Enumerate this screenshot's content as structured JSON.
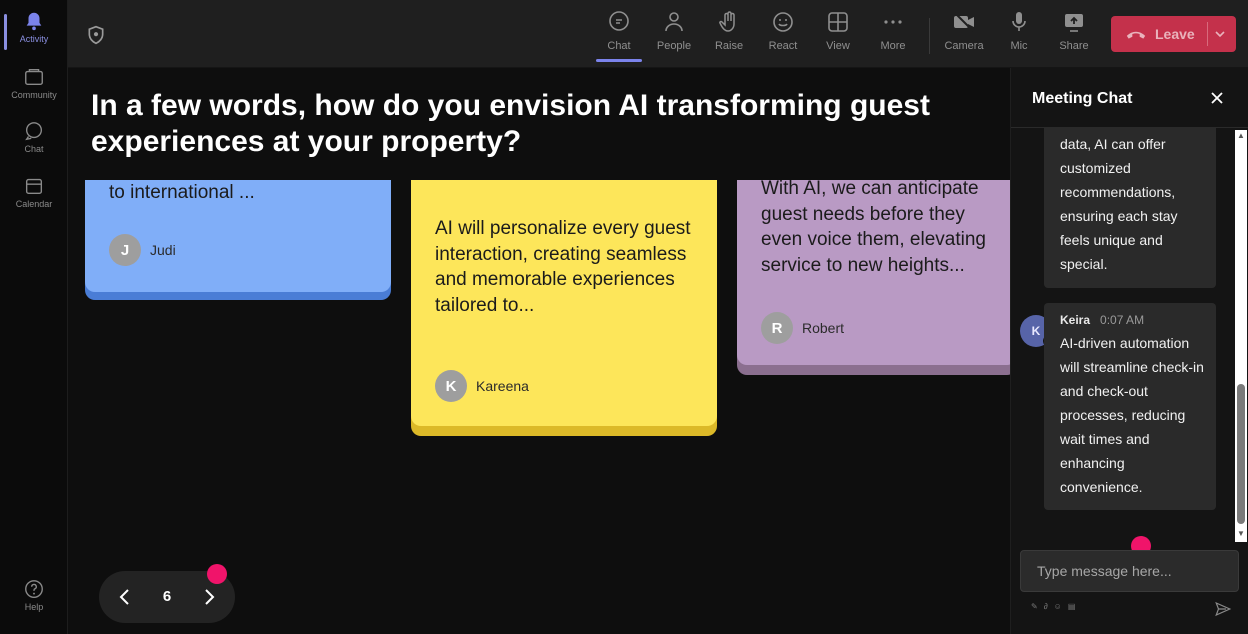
{
  "rail": {
    "items": [
      {
        "label": "Activity",
        "icon": "bell-icon",
        "active": true
      },
      {
        "label": "Community",
        "icon": "community-icon"
      },
      {
        "label": "Chat",
        "icon": "chat-icon"
      },
      {
        "label": "Calendar",
        "icon": "calendar-icon"
      },
      {
        "label": "Help",
        "icon": "help-icon"
      }
    ]
  },
  "toolbar": {
    "chat": "Chat",
    "people": "People",
    "raise": "Raise",
    "react": "React",
    "view": "View",
    "more": "More",
    "camera": "Camera",
    "mic": "Mic",
    "share": "Share",
    "leave": "Leave"
  },
  "stage": {
    "question": "In a few words, how do you envision AI transforming guest experiences at your property?",
    "notes": [
      {
        "text": "to international ...",
        "author": "Judi",
        "initial": "J",
        "color": "#80aef8"
      },
      {
        "text": "AI will personalize every guest interaction, creating seamless and memorable experiences tailored to...",
        "author": "Kareena",
        "initial": "K",
        "color": "#fde65a"
      },
      {
        "text": "With AI, we can anticipate guest needs before they even voice them, elevating service to new heights...",
        "author": "Robert",
        "initial": "R",
        "color": "#b99ac4"
      }
    ],
    "page": "6"
  },
  "chat": {
    "title": "Meeting Chat",
    "messages": [
      {
        "text": "data, AI can offer customized recommendations, ensuring each stay feels unique and special."
      },
      {
        "name": "Keira",
        "time": "0:07 AM",
        "initial": "K",
        "text": "AI-driven automation will streamline check-in and check-out processes, reducing wait times and enhancing convenience."
      }
    ],
    "input_placeholder": "Type message here..."
  },
  "colors": {
    "accent": "#7b83eb",
    "leave": "#c4314b",
    "marker": "#f0146a"
  }
}
